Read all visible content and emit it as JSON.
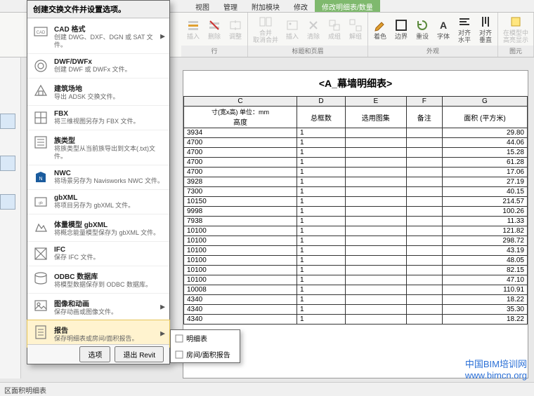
{
  "tabs": [
    "视图",
    "管理",
    "附加模块",
    "修改",
    "修改明细表/数量"
  ],
  "active_tab_index": 4,
  "ribbon_groups": [
    {
      "label": "行",
      "buttons": [
        {
          "name": "insert",
          "label": "插入",
          "icon": "row-insert",
          "disabled": true
        },
        {
          "name": "delete",
          "label": "删除",
          "icon": "row-delete",
          "disabled": true
        },
        {
          "name": "adjust",
          "label": "调整",
          "icon": "row-adjust",
          "disabled": true
        }
      ]
    },
    {
      "label": "标题和页眉",
      "buttons": [
        {
          "name": "merge",
          "label": "合并\n取消合并",
          "icon": "merge",
          "disabled": true
        },
        {
          "name": "insert-img",
          "label": "插入",
          "icon": "img",
          "disabled": true
        },
        {
          "name": "clear",
          "label": "清除",
          "icon": "clear",
          "disabled": true
        },
        {
          "name": "group",
          "label": "成组",
          "icon": "group",
          "disabled": true
        },
        {
          "name": "ungroup",
          "label": "解组",
          "icon": "ungroup",
          "disabled": true
        }
      ]
    },
    {
      "label": "外观",
      "buttons": [
        {
          "name": "color",
          "label": "着色",
          "icon": "paint"
        },
        {
          "name": "border",
          "label": "边界",
          "icon": "border"
        },
        {
          "name": "reset",
          "label": "重设",
          "icon": "reset"
        },
        {
          "name": "font",
          "label": "字体",
          "icon": "font"
        },
        {
          "name": "halign",
          "label": "对齐\n水平",
          "icon": "halign"
        },
        {
          "name": "valign",
          "label": "对齐\n垂直",
          "icon": "valign"
        }
      ]
    },
    {
      "label": "图元",
      "buttons": [
        {
          "name": "in-model",
          "label": "在模型中\n高亮显示",
          "icon": "highlight",
          "disabled": true
        }
      ]
    }
  ],
  "menu": {
    "header": "创建交换文件并设置选项。",
    "items": [
      {
        "title": "CAD 格式",
        "desc": "创建 DWG、DXF、DGN 或 SAT 文件。",
        "icon": "cad",
        "arrow": true
      },
      {
        "title": "DWF/DWFx",
        "desc": "创建 DWF 或 DWFx 文件。",
        "icon": "dwf"
      },
      {
        "title": "建筑场地",
        "desc": "导出 ADSK 交换文件。",
        "icon": "site"
      },
      {
        "title": "FBX",
        "desc": "将三维视图另存为 FBX 文件。",
        "icon": "fbx"
      },
      {
        "title": "族类型",
        "desc": "将族类型从当前族导出到文本(.txt)文件。",
        "icon": "fam"
      },
      {
        "title": "NWC",
        "desc": "将场景另存为 Navisworks NWC 文件。",
        "icon": "nwc"
      },
      {
        "title": "gbXML",
        "desc": "将项目另存为 gbXML 文件。",
        "icon": "gbxml"
      },
      {
        "title": "体量模型 gbXML",
        "desc": "将概念能量模型保存为 gbXML 文件。",
        "icon": "mass"
      },
      {
        "title": "IFC",
        "desc": "保存 IFC 文件。",
        "icon": "ifc"
      },
      {
        "title": "ODBC 数据库",
        "desc": "将模型数据保存到 ODBC 数据库。",
        "icon": "odbc"
      },
      {
        "title": "图像和动画",
        "desc": "保存动画或图像文件。",
        "icon": "img",
        "arrow": true
      },
      {
        "title": "报告",
        "desc": "保存明细表或房间/面积报告。",
        "icon": "report",
        "arrow": true,
        "hover": true
      }
    ],
    "footer": {
      "options": "选项",
      "exit": "退出 Revit"
    }
  },
  "submenu": [
    {
      "label": "明细表",
      "icon": "sched"
    },
    {
      "label": "房间/面积报告",
      "icon": "room"
    }
  ],
  "schedule": {
    "title": "<A_幕墙明细表>",
    "unit_header": "寸(宽x高) 单位：mm",
    "col_letters": [
      "C",
      "D",
      "E",
      "F",
      "G"
    ],
    "col_headers": [
      "高度",
      "总框数",
      "选用图集",
      "备注",
      "面积 (平方米)"
    ],
    "rows": [
      [
        "3934",
        "1",
        "",
        "",
        "29.80"
      ],
      [
        "4700",
        "1",
        "",
        "",
        "44.06"
      ],
      [
        "4700",
        "1",
        "",
        "",
        "15.28"
      ],
      [
        "4700",
        "1",
        "",
        "",
        "61.28"
      ],
      [
        "4700",
        "1",
        "",
        "",
        "17.06"
      ],
      [
        "3928",
        "1",
        "",
        "",
        "27.19"
      ],
      [
        "7300",
        "1",
        "",
        "",
        "40.15"
      ],
      [
        "10150",
        "1",
        "",
        "",
        "214.57"
      ],
      [
        "9998",
        "1",
        "",
        "",
        "100.26"
      ],
      [
        "7938",
        "1",
        "",
        "",
        "11.33"
      ],
      [
        "10100",
        "1",
        "",
        "",
        "121.82"
      ],
      [
        "10100",
        "1",
        "",
        "",
        "298.72"
      ],
      [
        "10100",
        "1",
        "",
        "",
        "43.19"
      ],
      [
        "10100",
        "1",
        "",
        "",
        "48.05"
      ],
      [
        "10100",
        "1",
        "",
        "",
        "82.15"
      ],
      [
        "10100",
        "1",
        "",
        "",
        "47.10"
      ],
      [
        "10008",
        "1",
        "",
        "",
        "110.91"
      ],
      [
        "4340",
        "1",
        "",
        "",
        "18.22"
      ],
      [
        "4340",
        "1",
        "",
        "",
        "35.30"
      ],
      [
        "4340",
        "1",
        "",
        "",
        "18.22"
      ]
    ]
  },
  "status": "区面积明细表",
  "watermark": {
    "l1": "中国BIM培训网",
    "l2": "www.bimcn.org"
  },
  "chart_data": {
    "type": "table",
    "title": "<A_幕墙明细表>",
    "columns": [
      "高度",
      "总框数",
      "选用图集",
      "备注",
      "面积 (平方米)"
    ],
    "rows": [
      [
        3934,
        1,
        null,
        null,
        29.8
      ],
      [
        4700,
        1,
        null,
        null,
        44.06
      ],
      [
        4700,
        1,
        null,
        null,
        15.28
      ],
      [
        4700,
        1,
        null,
        null,
        61.28
      ],
      [
        4700,
        1,
        null,
        null,
        17.06
      ],
      [
        3928,
        1,
        null,
        null,
        27.19
      ],
      [
        7300,
        1,
        null,
        null,
        40.15
      ],
      [
        10150,
        1,
        null,
        null,
        214.57
      ],
      [
        9998,
        1,
        null,
        null,
        100.26
      ],
      [
        7938,
        1,
        null,
        null,
        11.33
      ],
      [
        10100,
        1,
        null,
        null,
        121.82
      ],
      [
        10100,
        1,
        null,
        null,
        298.72
      ],
      [
        10100,
        1,
        null,
        null,
        43.19
      ],
      [
        10100,
        1,
        null,
        null,
        48.05
      ],
      [
        10100,
        1,
        null,
        null,
        82.15
      ],
      [
        10100,
        1,
        null,
        null,
        47.1
      ],
      [
        10008,
        1,
        null,
        null,
        110.91
      ],
      [
        4340,
        1,
        null,
        null,
        18.22
      ],
      [
        4340,
        1,
        null,
        null,
        35.3
      ],
      [
        4340,
        1,
        null,
        null,
        18.22
      ]
    ]
  }
}
